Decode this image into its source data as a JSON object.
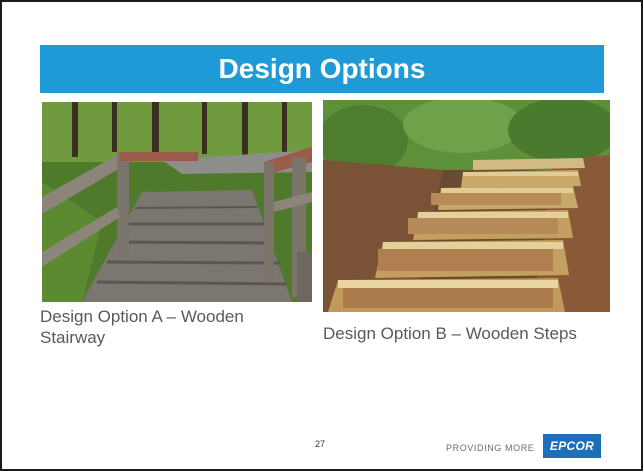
{
  "slide": {
    "title": "Design Options",
    "options": [
      {
        "caption": "Design Option A – Wooden Stairway",
        "image": "wooden-stairway-photo"
      },
      {
        "caption": "Design Option B – Wooden Steps",
        "image": "wooden-steps-photo"
      }
    ],
    "page_number": "27",
    "footer_tagline": "PROVIDING MORE",
    "logo_text": "EPCOR"
  },
  "colors": {
    "title_bar": "#1e9bd7",
    "caption_text": "#595959",
    "logo_background": "#1d6fb8"
  }
}
